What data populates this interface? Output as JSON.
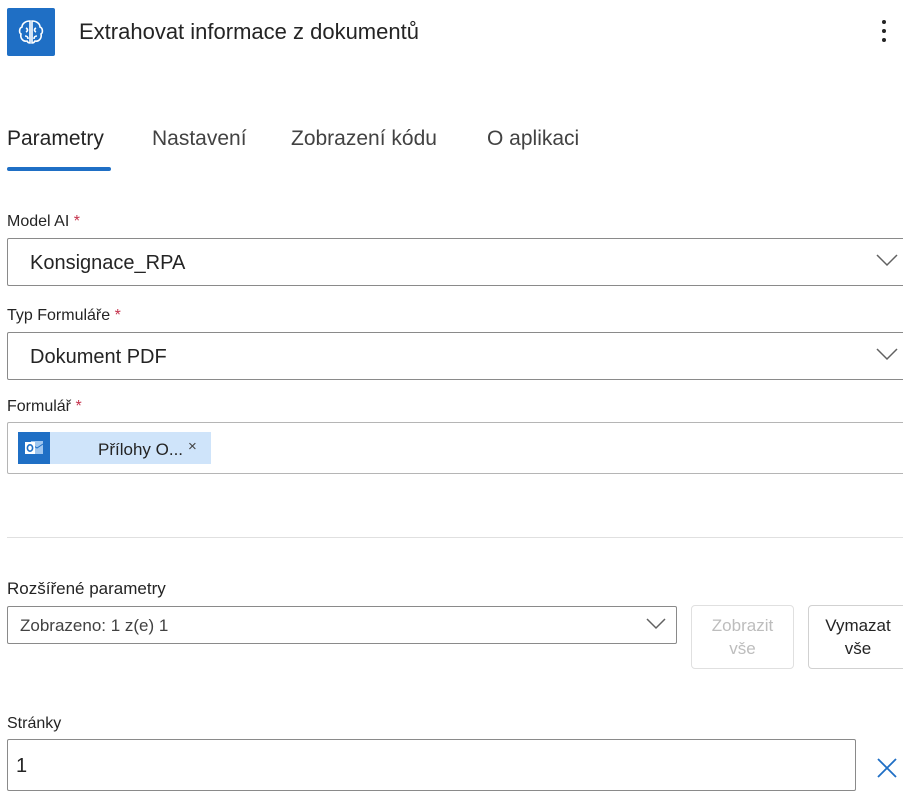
{
  "header": {
    "title": "Extrahovat informace z dokumentů",
    "app_icon": "ai-builder-brain-icon",
    "menu_icon": "more-vertical-icon"
  },
  "tabs": [
    {
      "label": "Parametry",
      "active": true
    },
    {
      "label": "Nastavení",
      "active": false
    },
    {
      "label": "Zobrazení kódu",
      "active": false
    },
    {
      "label": "O aplikaci",
      "active": false
    }
  ],
  "fields": {
    "model": {
      "label": "Model AI",
      "required": "*",
      "value": "Konsignace_RPA"
    },
    "form_type": {
      "label": "Typ Formuláře",
      "required": "*",
      "value": "Dokument PDF"
    },
    "form": {
      "label": "Formulář",
      "required": "*",
      "chip_label": "Přílohy O...",
      "chip_remove": "×",
      "chip_icon": "outlook-icon"
    }
  },
  "advanced": {
    "label": "Rozšířené parametry",
    "select_value": "Zobrazeno: 1 z(e) 1",
    "show_all": "Zobrazit\nvše",
    "clear_all": "Vymazat\nvše"
  },
  "pages": {
    "label": "Stránky",
    "value": "1"
  },
  "colors": {
    "accent": "#1f6fc5",
    "required": "#c4314b",
    "chip_bg": "#cfe4fa"
  }
}
